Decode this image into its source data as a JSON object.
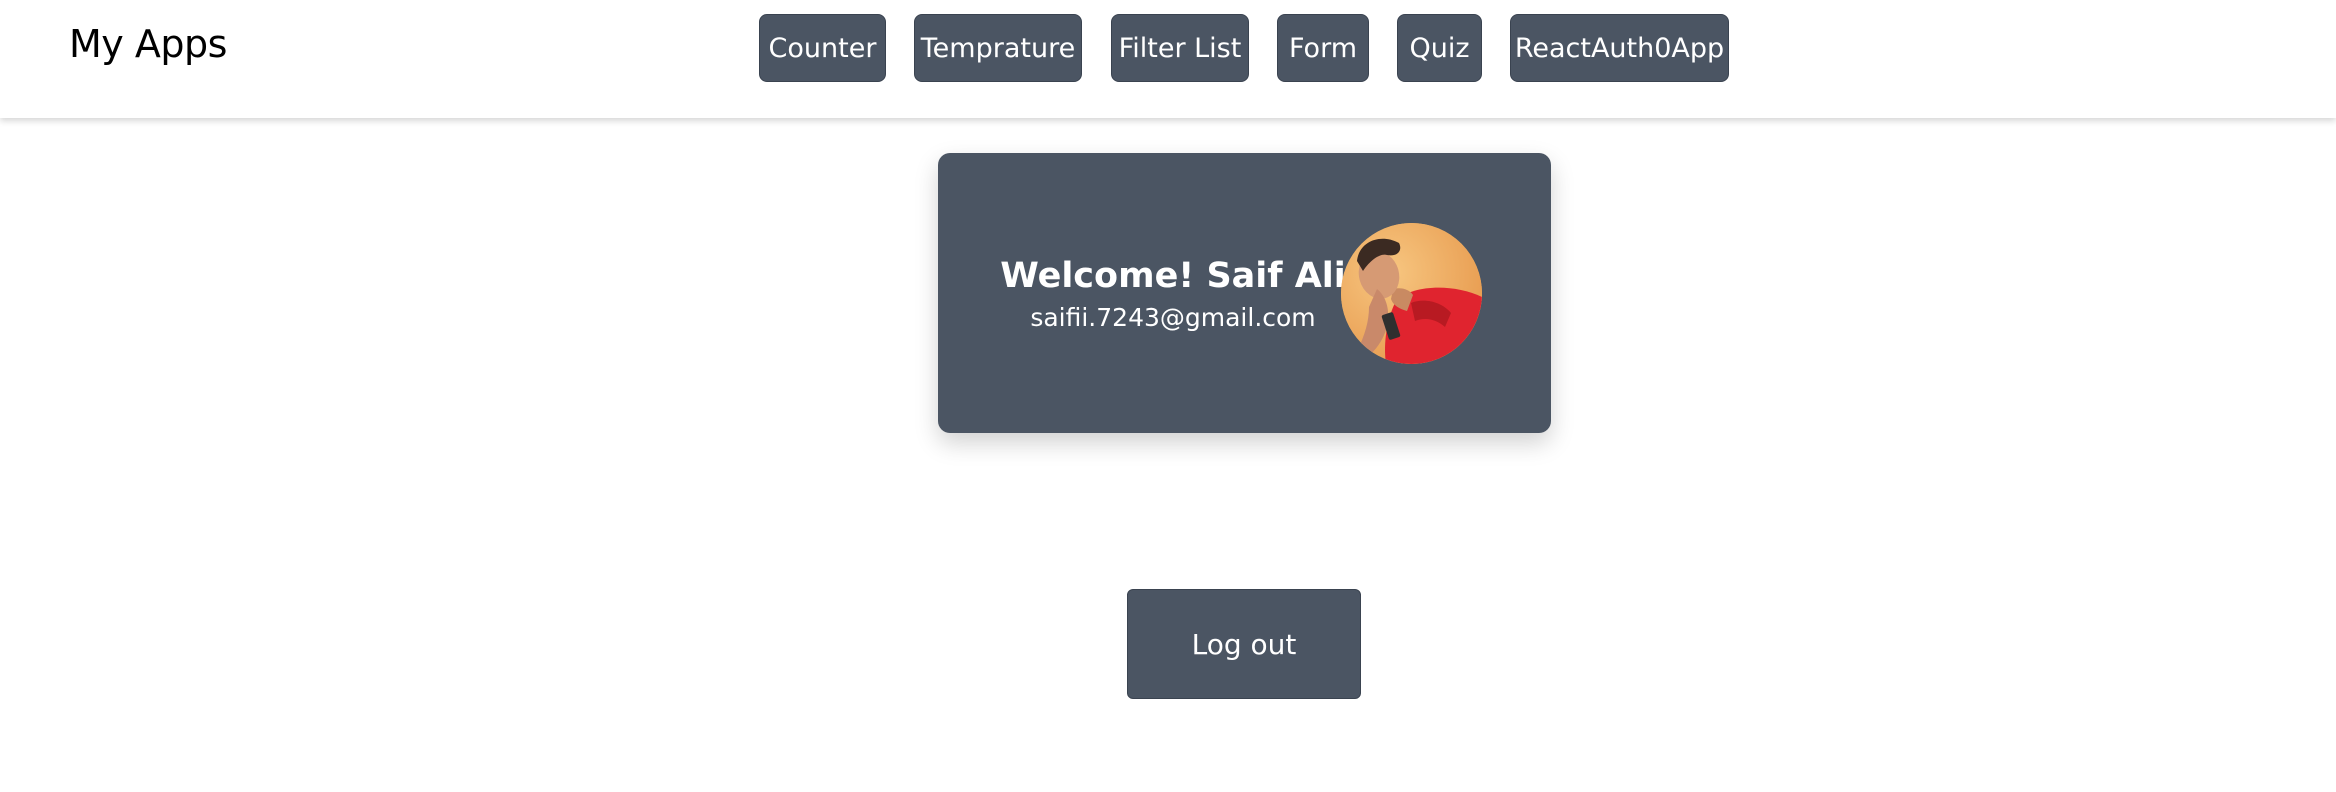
{
  "header": {
    "brand": "My Apps",
    "nav": [
      {
        "label": "Counter"
      },
      {
        "label": "Temprature"
      },
      {
        "label": "Filter List"
      },
      {
        "label": "Form"
      },
      {
        "label": "Quiz"
      },
      {
        "label": "ReactAuth0App"
      }
    ]
  },
  "profile": {
    "welcome": "Welcome! Saif Ali",
    "email": "saifii.7243@gmail.com",
    "avatar_icon": "user-photo"
  },
  "actions": {
    "logout_label": "Log out"
  },
  "colors": {
    "button_bg": "#4b5563",
    "text_light": "#ffffff"
  }
}
